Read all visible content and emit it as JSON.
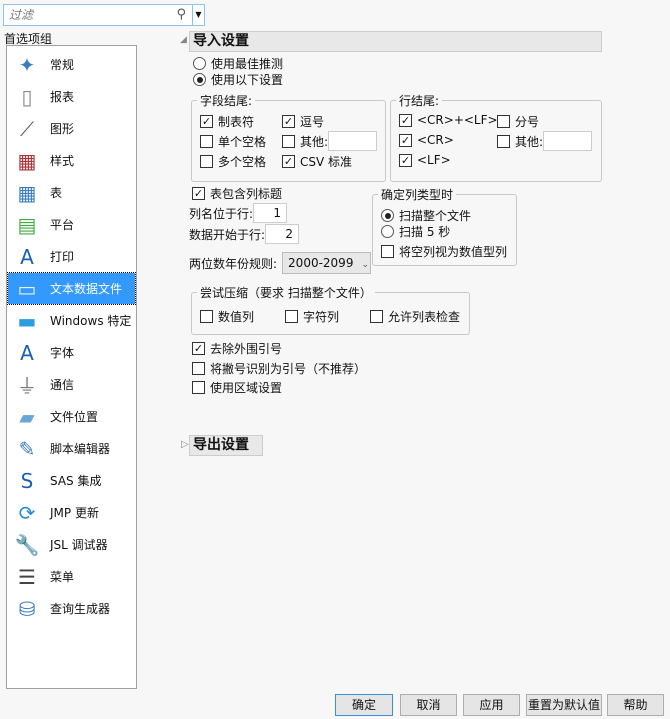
{
  "filter": {
    "placeholder": "过滤"
  },
  "group_label": "首选项组",
  "sidebar": {
    "items": [
      {
        "label": "常规",
        "icon": "jmp-logo-icon"
      },
      {
        "label": "报表",
        "icon": "report-icon"
      },
      {
        "label": "图形",
        "icon": "graph-icon"
      },
      {
        "label": "样式",
        "icon": "style-icon"
      },
      {
        "label": "表",
        "icon": "table-icon"
      },
      {
        "label": "平台",
        "icon": "platform-icon"
      },
      {
        "label": "打印",
        "icon": "print-icon"
      },
      {
        "label": "文本数据文件",
        "icon": "txt-file-icon",
        "selected": true
      },
      {
        "label": "Windows 特定",
        "icon": "monitor-icon"
      },
      {
        "label": "字体",
        "icon": "font-icon"
      },
      {
        "label": "通信",
        "icon": "usb-icon"
      },
      {
        "label": "文件位置",
        "icon": "folder-icon"
      },
      {
        "label": "脚本编辑器",
        "icon": "script-editor-icon"
      },
      {
        "label": "SAS 集成",
        "icon": "sas-icon"
      },
      {
        "label": "JMP 更新",
        "icon": "update-icon"
      },
      {
        "label": "JSL 调试器",
        "icon": "wrench-icon"
      },
      {
        "label": "菜单",
        "icon": "menu-icon"
      },
      {
        "label": "查询生成器",
        "icon": "database-icon"
      }
    ]
  },
  "import": {
    "title": "导入设置",
    "radio_best": "使用最佳推测",
    "radio_following": "使用以下设置",
    "field_end": {
      "title": "字段结尾:",
      "tab": "制表符",
      "comma": "逗号",
      "space": "单个空格",
      "other": "其他:",
      "spaces": "多个空格",
      "csv": "CSV 标准"
    },
    "line_end": {
      "title": "行结尾:",
      "crlf": "<CR>+<LF>",
      "semicolon": "分号",
      "cr": "<CR>",
      "other": "其他:",
      "lf": "<LF>"
    },
    "has_headers": "表包含列标题",
    "col_names_row_label": "列名位于行:",
    "col_names_row": "1",
    "data_start_label": "数据开始于行:",
    "data_start": "2",
    "year_rule_label": "两位数年份规则:",
    "year_rule": "2000-2099",
    "col_type": {
      "title": "确定列类型时",
      "scan_all": "扫描整个文件",
      "scan_5": "扫描 5 秒",
      "empty_numeric": "将空列视为数值型列"
    },
    "compress": {
      "title": "尝试压缩（要求 扫描整个文件）",
      "numeric": "数值列",
      "char": "字符列",
      "allow_list": "允许列表检查"
    },
    "strip_quotes": "去除外围引号",
    "apostrophe": "将撇号识别为引号（不推荐）",
    "locale": "使用区域设置"
  },
  "export": {
    "title": "导出设置"
  },
  "buttons": {
    "ok": "确定",
    "cancel": "取消",
    "apply": "应用",
    "reset": "重置为默认值",
    "help": "帮助"
  }
}
